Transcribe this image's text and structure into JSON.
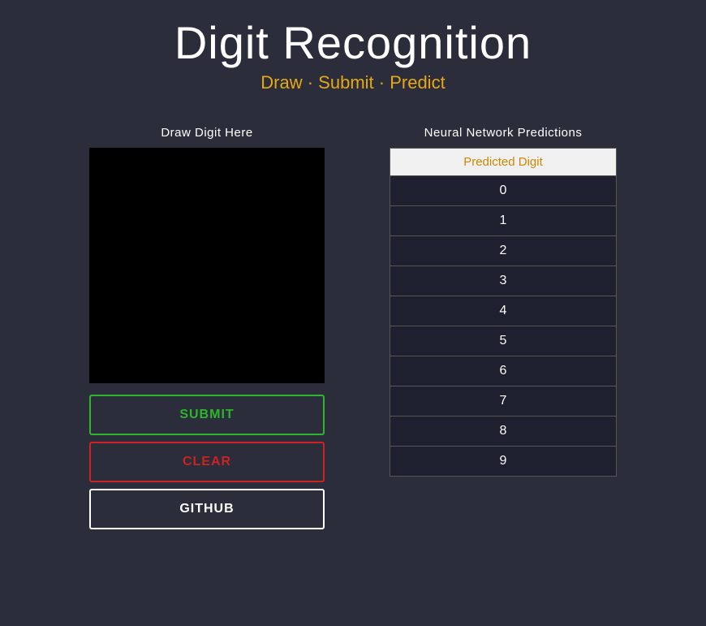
{
  "header": {
    "title": "Digit Recognition",
    "subtitle": "Draw · Submit · Predict"
  },
  "left_panel": {
    "label": "Draw Digit Here",
    "buttons": {
      "submit_label": "SUBMIT",
      "clear_label": "CLEAR",
      "github_label": "GITHUB"
    }
  },
  "right_panel": {
    "label": "Neural Network Predictions",
    "table_header": "Predicted Digit",
    "digits": [
      {
        "value": "0"
      },
      {
        "value": "1"
      },
      {
        "value": "2"
      },
      {
        "value": "3"
      },
      {
        "value": "4"
      },
      {
        "value": "5"
      },
      {
        "value": "6"
      },
      {
        "value": "7"
      },
      {
        "value": "8"
      },
      {
        "value": "9"
      }
    ]
  },
  "colors": {
    "accent": "#e6a817",
    "submit_green": "#2db52d",
    "clear_red": "#cc2222",
    "background": "#2b2d3a"
  }
}
